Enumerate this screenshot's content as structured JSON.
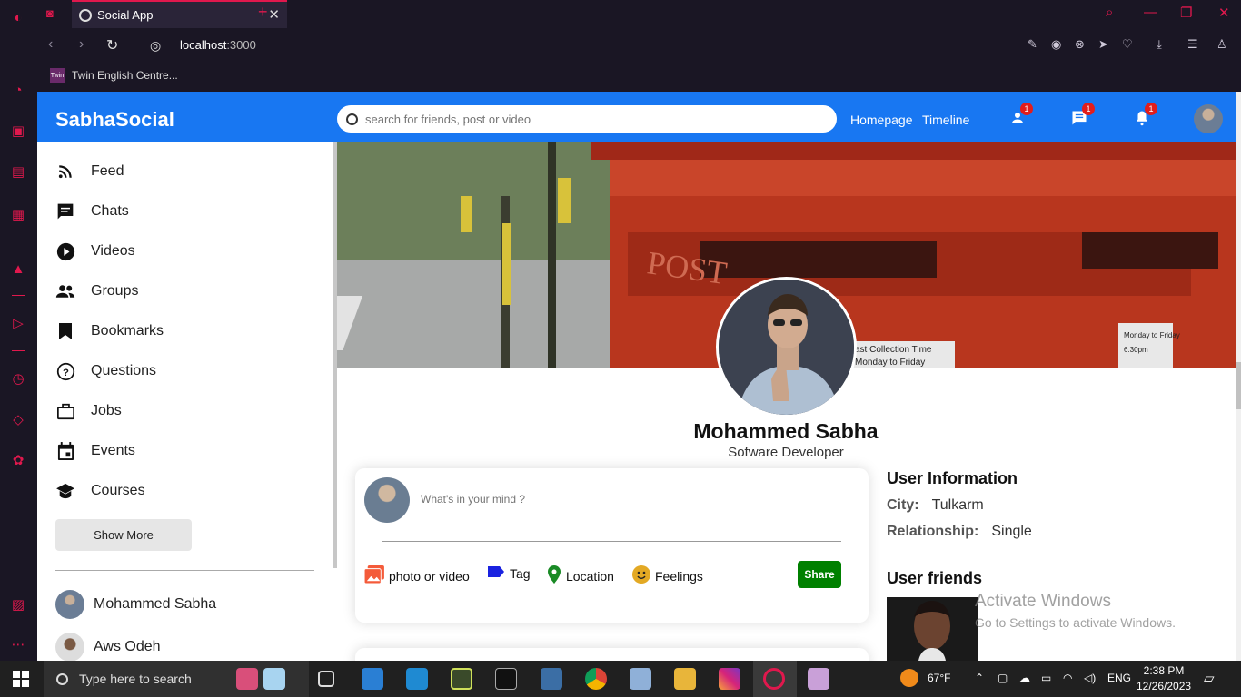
{
  "browser": {
    "tab_title": "Social App",
    "close_tab": "✕",
    "new_tab": "+",
    "url_host": "localhost",
    "url_port": ":3000",
    "bookmark": "Twin English Centre...",
    "bookmark_icon_text": "Twin"
  },
  "header": {
    "logo": "SabhaSocial",
    "search_placeholder": "search for friends, post or video",
    "links": [
      "Homepage",
      "Timeline"
    ],
    "badges": {
      "friends": "1",
      "messages": "1",
      "notifications": "1"
    }
  },
  "sidebar": {
    "items": [
      {
        "label": "Feed",
        "icon": "rss-feed-icon"
      },
      {
        "label": "Chats",
        "icon": "chat-icon"
      },
      {
        "label": "Videos",
        "icon": "play-circle-icon"
      },
      {
        "label": "Groups",
        "icon": "group-icon"
      },
      {
        "label": "Bookmarks",
        "icon": "bookmark-icon"
      },
      {
        "label": "Questions",
        "icon": "help-circle-icon"
      },
      {
        "label": "Jobs",
        "icon": "briefcase-icon"
      },
      {
        "label": "Events",
        "icon": "event-icon"
      },
      {
        "label": "Courses",
        "icon": "school-icon"
      }
    ],
    "show_more": "Show More",
    "friends": [
      "Mohammed Sabha",
      "Aws Odeh"
    ]
  },
  "profile": {
    "name": "Mohammed Sabha",
    "description": "Sofware Developer"
  },
  "share": {
    "placeholder": "What's in your mind ?",
    "options": [
      "photo or video",
      "Tag",
      "Location",
      "Feelings"
    ],
    "button": "Share"
  },
  "user_info": {
    "title": "User Information",
    "city_label": "City:",
    "city": "Tulkarm",
    "relationship_label": "Relationship:",
    "relationship": "Single",
    "friends_title": "User friends"
  },
  "watermark": {
    "line1": "Activate Windows",
    "line2": "Go to Settings to activate Windows."
  },
  "taskbar": {
    "search": "Type here to search",
    "weather": "67°F",
    "lang": "ENG",
    "time": "2:38 PM",
    "date": "12/26/2023"
  },
  "colors": {
    "brand": "#1877f2",
    "opera_red": "#e0184d",
    "share_green": "#008000",
    "badge_red": "#e21d1d"
  }
}
